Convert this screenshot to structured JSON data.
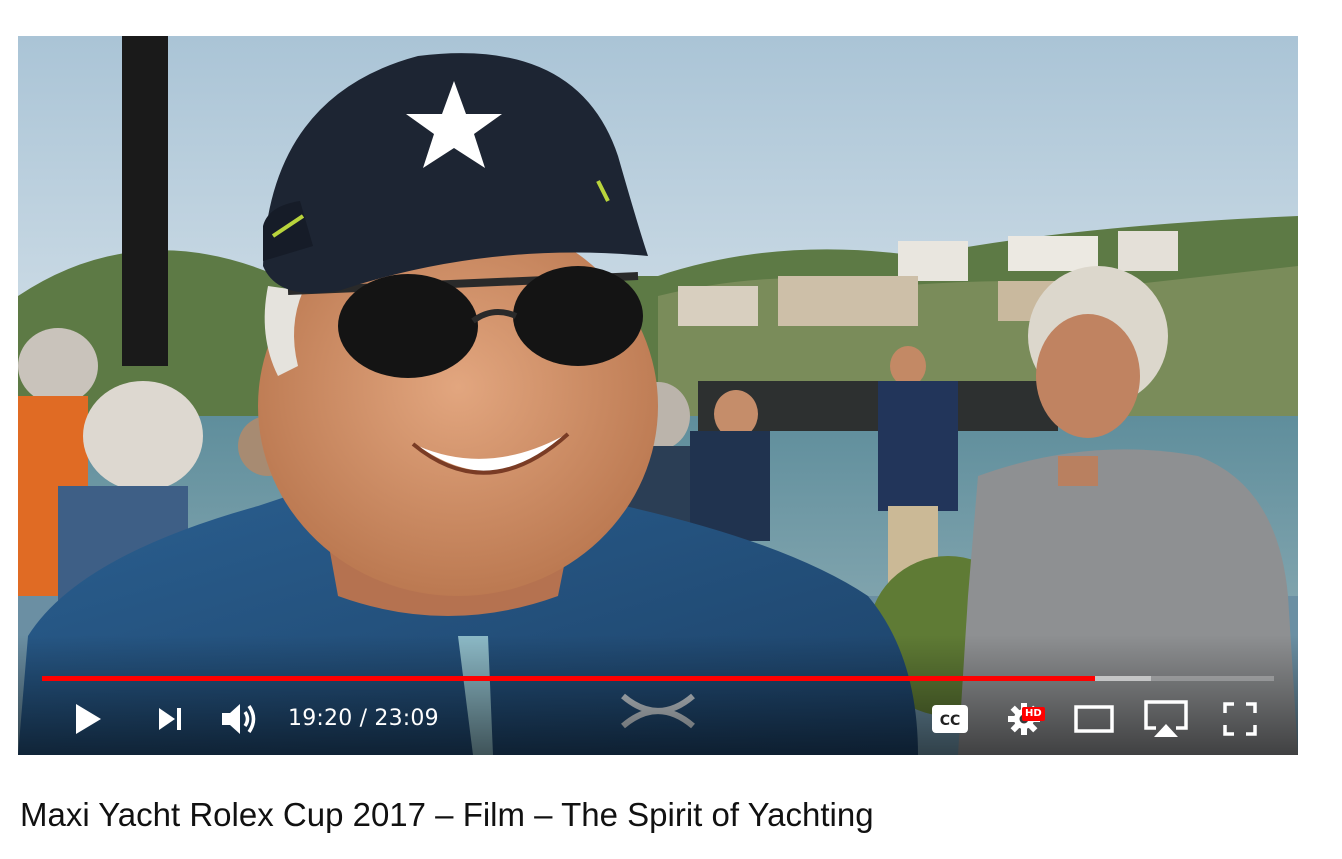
{
  "video": {
    "title": "Maxi Yacht Rolex Cup 2017 – Film – The Spirit of Yachting",
    "current_time": "19:20",
    "duration": "23:09",
    "time_display": "19:20 / 23:09",
    "progress_played": 0.855,
    "progress_buffered": 0.9,
    "quality_badge": "HD"
  },
  "controls": {
    "icons": [
      "play-icon",
      "next-icon",
      "volume-icon",
      "captions-icon",
      "settings-icon",
      "miniplayer-icon",
      "airplay-icon",
      "fullscreen-icon"
    ],
    "captions_label": "CC"
  },
  "colors": {
    "progress": "#ff0000",
    "hd_badge": "#ff0000",
    "controls": "#ffffff",
    "title_text": "#111111"
  }
}
